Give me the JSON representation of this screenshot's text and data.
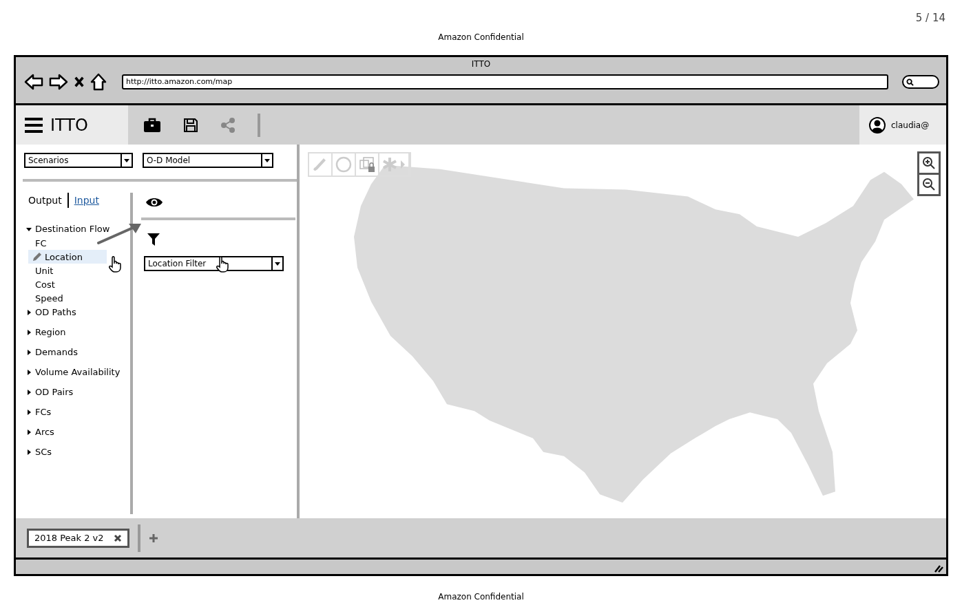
{
  "page": {
    "number": "5 / 14",
    "header": "Amazon Confidential",
    "footer": "Amazon Confidential"
  },
  "browser": {
    "title": "ITTO",
    "url": "http://itto.amazon.com/map"
  },
  "app": {
    "name": "ITTO",
    "user": "claudia@"
  },
  "selectors": [
    {
      "value": "Scenarios"
    },
    {
      "value": "O-D Model"
    }
  ],
  "panel_tabs": [
    {
      "label": "Output",
      "selected": true
    },
    {
      "label": "Input",
      "selected": false
    }
  ],
  "tree": [
    {
      "label": "Destination Flow",
      "expanded": true,
      "selected": false,
      "children": [
        {
          "label": "FC",
          "selected": false
        },
        {
          "label": "Location",
          "selected": true
        },
        {
          "label": "Unit",
          "selected": false
        },
        {
          "label": "Cost",
          "selected": false
        },
        {
          "label": "Speed",
          "selected": false
        }
      ]
    },
    {
      "label": "OD Paths",
      "expanded": false,
      "selected": false
    },
    {
      "label": "Region",
      "expanded": false,
      "selected": false
    },
    {
      "label": "Demands",
      "expanded": false,
      "selected": false
    },
    {
      "label": "Volume Availability",
      "expanded": false,
      "selected": false
    },
    {
      "label": "OD Pairs",
      "expanded": false,
      "selected": false
    },
    {
      "label": "FCs",
      "expanded": false,
      "selected": false
    },
    {
      "label": "Arcs",
      "expanded": false,
      "selected": false
    },
    {
      "label": "SCs",
      "expanded": false,
      "selected": false
    }
  ],
  "filter": {
    "value": "Location Filter"
  },
  "scenario_tabs": [
    {
      "label": "2018 Peak 2 v2",
      "selected": true
    }
  ]
}
